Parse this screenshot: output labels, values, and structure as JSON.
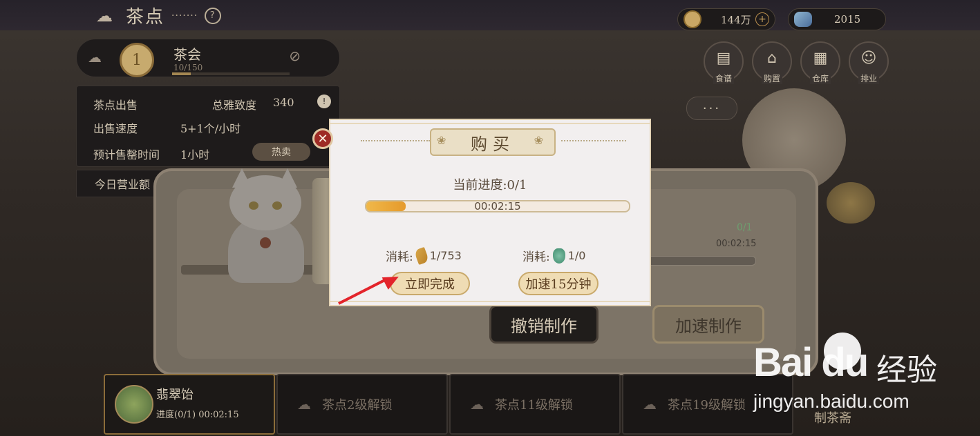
{
  "header": {
    "title": "茶点",
    "title_dots": "·······",
    "help_icon": "?"
  },
  "currency": {
    "coins": "144万",
    "gems": "2015",
    "plus": "+"
  },
  "top_buttons": [
    {
      "label": "食谱",
      "icon": "recipe-book-icon"
    },
    {
      "label": "购置",
      "icon": "shop-icon"
    },
    {
      "label": "仓库",
      "icon": "warehouse-icon"
    },
    {
      "label": "排业",
      "icon": "ranking-icon"
    }
  ],
  "more_button": "···",
  "shop": {
    "level": "1",
    "name": "茶会",
    "count": "10/150",
    "level_progress": 0.16
  },
  "info": {
    "sale_title": "茶点出售",
    "favor_label": "总雅致度",
    "favor_value": "340",
    "speed_label": "出售速度",
    "speed_value": "5+1个/小时",
    "sellout_label": "预计售罄时间",
    "sellout_value": "1小时",
    "tag_button": "热卖",
    "revenue_label": "今日营业额"
  },
  "work": {
    "count": "0/1",
    "time": "00:02:15",
    "cancel_button": "撤销制作",
    "speed_button": "加速制作"
  },
  "slots": [
    {
      "name": "翡翠饴",
      "progress": "进度(0/1) 00:02:15"
    },
    {
      "name": "茶点2级解锁"
    },
    {
      "name": "茶点11级解锁"
    },
    {
      "name": "茶点19级解锁"
    }
  ],
  "workshop_label": "制茶斋",
  "dialog": {
    "title": "购买",
    "progress_label": "当前进度:0/1",
    "timer": "00:02:15",
    "progress_fraction": 0.15,
    "cost1_label": "消耗:",
    "cost1_value": "1/753",
    "cost2_label": "消耗:",
    "cost2_value": "1/0",
    "button_complete": "立即完成",
    "button_speedup": "加速15分钟",
    "close_icon": "✕"
  },
  "watermark": {
    "logo": "Bai du",
    "cn": "经验",
    "url": "jingyan.baidu.com"
  },
  "colors": {
    "annotation_arrow": "#e3242b",
    "close_button": "#9e2b25",
    "progress_fill": "#e59a2b"
  }
}
